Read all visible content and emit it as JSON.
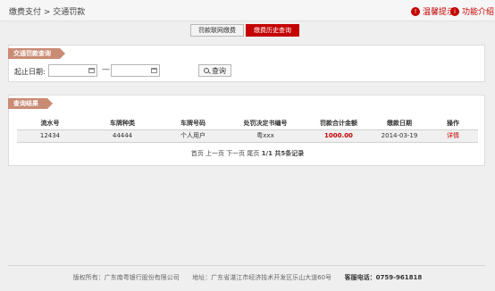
{
  "header": {
    "breadcrumb": "缴费支付 > 交通罚款",
    "hint_label": "温馨提示",
    "intro_label": "功能介绍"
  },
  "tabs": [
    {
      "label": "罚款联网缴费"
    },
    {
      "label": "缴费历史查询"
    }
  ],
  "query": {
    "title": "交通罚款查询",
    "date_label": "起止日期:",
    "start_date": "",
    "end_date": "",
    "separator": "—",
    "button": "查询"
  },
  "results": {
    "title": "查询结果",
    "columns": [
      "流水号",
      "车牌种类",
      "车牌号码",
      "处罚决定书编号",
      "罚款合计金额",
      "缴款日期",
      "操作"
    ],
    "rows": [
      {
        "serial": "12434",
        "plate_type": "44444",
        "plate_no": "个人用户",
        "decision_no": "粤xxx",
        "amount": "1000.00",
        "date": "2014-03-19",
        "action": "详情"
      }
    ],
    "pager": {
      "first": "首页",
      "prev": "上一页",
      "next": "下一页",
      "last": "尾页",
      "summary": "1/1 共5条记录"
    }
  },
  "footer": {
    "copyright": "版权所有：广东南粤银行股份有限公司",
    "address": "地址：广东省湛江市经济技术开发区乐山大道60号",
    "hotline_label": "客服电话：",
    "hotline": "0759-961818"
  },
  "colors": {
    "accent": "#c40000",
    "ribbon": "#c98b74"
  },
  "icons": {
    "hint": "warning-icon",
    "intro": "book-icon"
  }
}
